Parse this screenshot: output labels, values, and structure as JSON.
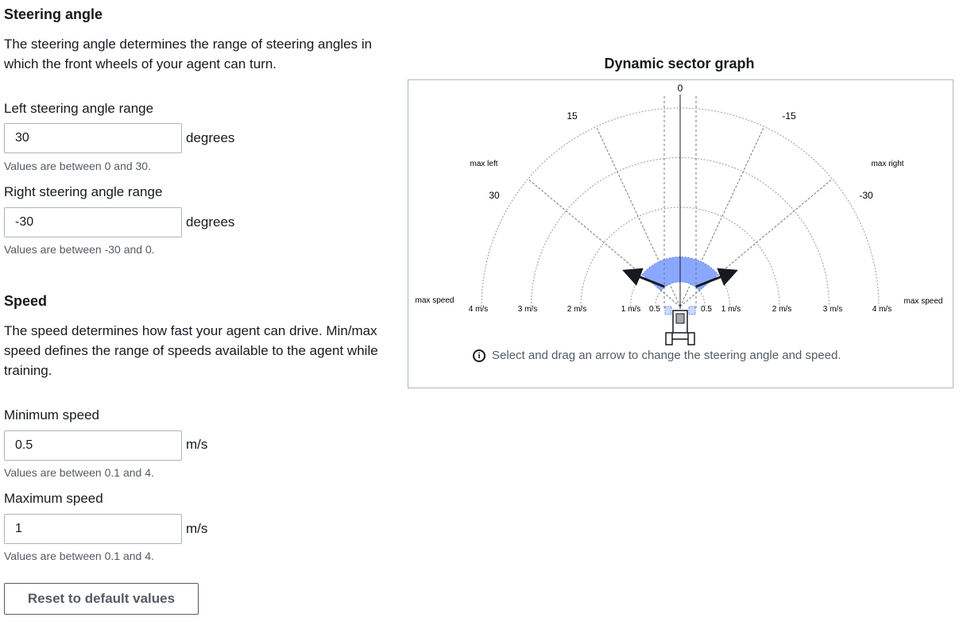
{
  "steering": {
    "heading": "Steering angle",
    "description": "The steering angle determines the range of steering angles in which the front wheels of your agent can turn.",
    "left_label": "Left steering angle range",
    "left_value": "30",
    "left_unit": "degrees",
    "left_hint": "Values are between 0 and 30.",
    "right_label": "Right steering angle range",
    "right_value": "-30",
    "right_unit": "degrees",
    "right_hint": "Values are between -30 and 0."
  },
  "speed": {
    "heading": "Speed",
    "description": "The speed determines how fast your agent can drive. Min/max speed defines the range of speeds available to the agent while training.",
    "min_label": "Minimum speed",
    "min_value": "0.5",
    "min_unit": "m/s",
    "min_hint": "Values are between 0.1 and 4.",
    "max_label": "Maximum speed",
    "max_value": "1",
    "max_unit": "m/s",
    "max_hint": "Values are between 0.1 and 4."
  },
  "reset_button": "Reset to default values",
  "graph": {
    "title": "Dynamic sector graph",
    "angle_labels": {
      "zero": "0",
      "left_mid": "15",
      "right_mid": "-15",
      "left_max": "30",
      "right_max": "-30"
    },
    "max_left": "max left",
    "max_right": "max right",
    "max_speed_left": "max speed",
    "max_speed_right": "max speed",
    "speed_left": [
      "4 m/s",
      "3 m/s",
      "2 m/s",
      "1 m/s",
      "0.5"
    ],
    "speed_right": [
      "0.5",
      "1 m/s",
      "2 m/s",
      "3 m/s",
      "4 m/s"
    ],
    "info_text": "Select and drag an arrow to change the steering angle and speed.",
    "sector_color": "#8aa8ff",
    "sector": {
      "left_angle_deg": 30,
      "right_angle_deg": -30,
      "min_speed": 0.5,
      "max_speed": 1
    }
  }
}
